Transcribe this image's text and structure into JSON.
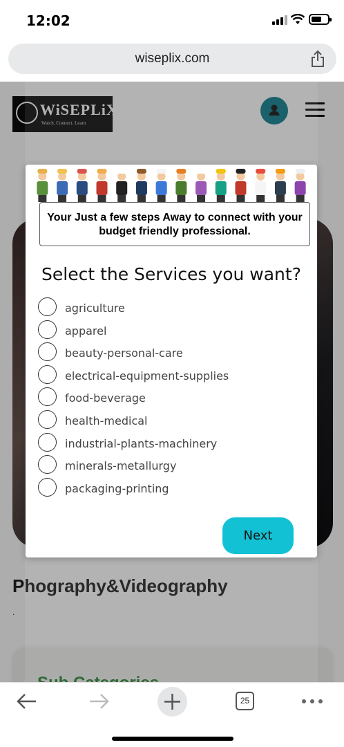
{
  "status_bar": {
    "time": "12:02"
  },
  "browser": {
    "url": "wiseplix.com",
    "tab_count": "25"
  },
  "site": {
    "logo_name": "WiSEPLiX",
    "logo_tagline": "Watch. Connect. Learn",
    "section_title": "Phography&Videography",
    "section_dot": ".",
    "subcategories_title": "Sub Categories"
  },
  "modal": {
    "banner_text": "Your Just a few steps Away to connect with your budget friendly professional.",
    "heading": "Select the Services you want?",
    "options": [
      {
        "label": "agriculture"
      },
      {
        "label": "apparel"
      },
      {
        "label": "beauty-personal-care"
      },
      {
        "label": "electrical-equipment-supplies"
      },
      {
        "label": "food-beverage"
      },
      {
        "label": "health-medical"
      },
      {
        "label": "industrial-plants-machinery"
      },
      {
        "label": "minerals-metallurgy"
      },
      {
        "label": "packaging-printing"
      }
    ],
    "next_label": "Next"
  },
  "colors": {
    "accent": "#13c1d5",
    "user_button": "#0b7d8c"
  }
}
